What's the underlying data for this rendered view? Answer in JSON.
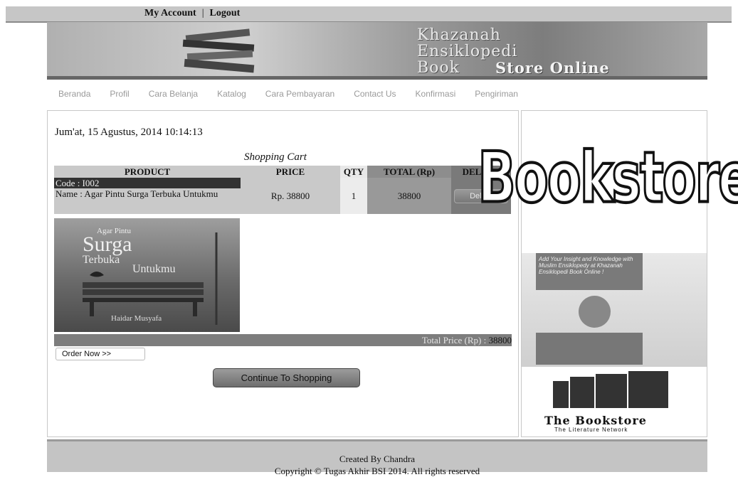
{
  "topbar": {
    "my_account": "My Account",
    "separator": "|",
    "logout": "Logout"
  },
  "banner": {
    "line1": "Khazanah",
    "line2": "Ensiklopedi",
    "line3": "Book",
    "line4": "Store Online"
  },
  "nav": [
    "Beranda",
    "Profil",
    "Cara Belanja",
    "Katalog",
    "Cara Pembayaran",
    "Contact Us",
    "Konfirmasi",
    "Pengiriman"
  ],
  "main": {
    "date": "Jum'at, 15 Agustus, 2014 10:14:13",
    "cart_title": "Shopping Cart",
    "headers": {
      "product": "PRODUCT",
      "price": "PRICE",
      "qty": "QTY",
      "total": "TOTAL (Rp)",
      "delete": "DELETE"
    },
    "item": {
      "code": "Code : I002",
      "name": "Name : Agar Pintu Surga Terbuka Untukmu",
      "price": "Rp. 38800",
      "qty": "1",
      "total": "38800",
      "delete_label": "Delete"
    },
    "cover": {
      "small": "Agar Pintu",
      "big": "Surga",
      "l3": "Terbuka",
      "l4": "Untukmu",
      "author": "Haidar Musyafa"
    },
    "total_label": "Total Price (Rp) : ",
    "total_value": "38800",
    "order_button": "Order Now >>",
    "continue_button": "Continue To Shopping"
  },
  "sidebar": {
    "bookstore_logo": "Bookstore",
    "promo_text": "Add Your Insight and Knowledge with Muslim Ensiklopedy at Khazanah Ensiklopedi Book Online !",
    "tbs_name": "The Bookstore",
    "tbs_sub": "The Literature Network"
  },
  "footer": {
    "line1": "Created By Chandra",
    "line2": "Copyright © Tugas Akhir BSI 2014. All rights reserved"
  }
}
